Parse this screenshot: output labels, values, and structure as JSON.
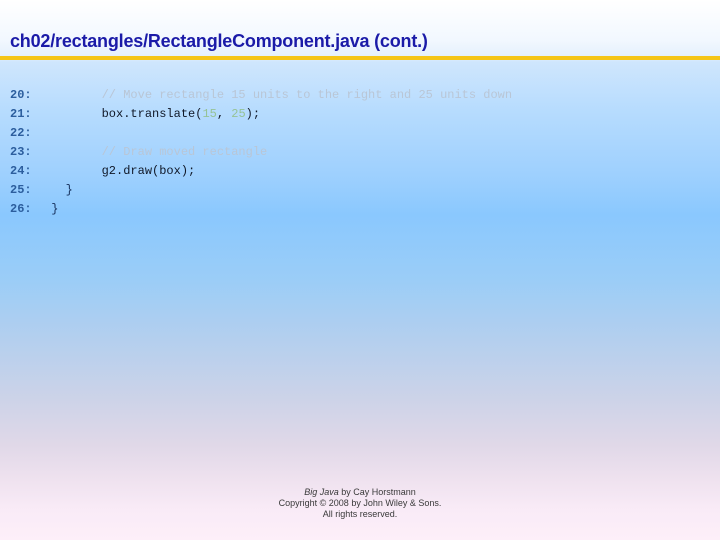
{
  "slide": {
    "title": "ch02/rectangles/RectangleComponent.java (cont.)",
    "accent_rule_color": "#F5C518",
    "title_color": "#1B1BA8",
    "background_top_color": "#FFFFFF",
    "background_mid_color": "#8AC8FE",
    "background_bottom_color": "#FDEFF9"
  },
  "code": {
    "language": "java",
    "comment_color": "#B9C6D6",
    "lineno_color": "#2C5E9E",
    "number_literal_color": "#96C396",
    "lines": [
      {
        "number": "20:",
        "indent": "        ",
        "parts": [
          {
            "kind": "comment",
            "text": "// Move rectangle 15 units to the right and 25 units down"
          }
        ]
      },
      {
        "number": "21:",
        "indent": "        ",
        "parts": [
          {
            "kind": "code",
            "text": "box.translate("
          },
          {
            "kind": "number",
            "text": "15"
          },
          {
            "kind": "code",
            "text": ", "
          },
          {
            "kind": "number",
            "text": "25"
          },
          {
            "kind": "code",
            "text": ");"
          }
        ]
      },
      {
        "number": "22:",
        "indent": "",
        "parts": []
      },
      {
        "number": "23:",
        "indent": "        ",
        "parts": [
          {
            "kind": "comment",
            "text": "// Draw moved rectangle"
          }
        ]
      },
      {
        "number": "24:",
        "indent": "        ",
        "parts": [
          {
            "kind": "code",
            "text": "g2.draw(box);"
          }
        ]
      },
      {
        "number": "25:",
        "indent": "   ",
        "parts": [
          {
            "kind": "brace",
            "text": "}"
          }
        ]
      },
      {
        "number": "26:",
        "indent": " ",
        "parts": [
          {
            "kind": "brace",
            "text": "}"
          }
        ]
      }
    ]
  },
  "footer": {
    "book_title": "Big Java",
    "byline": " by Cay Horstmann",
    "copyright": "Copyright © 2008 by John Wiley & Sons.",
    "rights": "All rights reserved."
  }
}
